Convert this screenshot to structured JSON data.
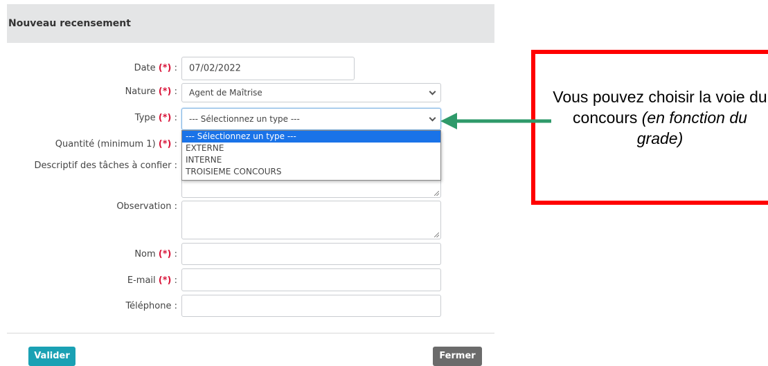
{
  "form": {
    "title": "Nouveau recensement",
    "required_marker": "(*)",
    "fields": {
      "date": {
        "label": "Date",
        "suffix": " :",
        "value": "07/02/2022"
      },
      "nature": {
        "label": "Nature",
        "suffix": " :",
        "value": "Agent de Maîtrise"
      },
      "type": {
        "label": "Type",
        "suffix": " :",
        "value": "--- Sélectionnez un type ---"
      },
      "quantite": {
        "label": "Quantité (minimum 1)",
        "suffix": " :"
      },
      "descriptif": {
        "label": "Descriptif des tâches à confier :"
      },
      "observation": {
        "label": "Observation :"
      },
      "nom": {
        "label": "Nom",
        "suffix": " :"
      },
      "email": {
        "label": "E-mail",
        "suffix": " :"
      },
      "telephone": {
        "label": "Téléphone :"
      }
    },
    "type_options": [
      "--- Sélectionnez un type ---",
      "EXTERNE",
      "INTERNE",
      "TROISIEME CONCOURS"
    ],
    "buttons": {
      "validate": "Valider",
      "close": "Fermer"
    }
  },
  "callout": {
    "text_normal": "Vous pouvez choisir la voie du concours ",
    "text_italic": "(en fonction du grade)",
    "border_color": "#ff0000",
    "arrow_color": "#2e9a6a"
  },
  "colors": {
    "required": "#d9163a",
    "validate_button": "#1aa1b4",
    "close_button": "#6b6b6b",
    "selected_option": "#1a73e8"
  }
}
